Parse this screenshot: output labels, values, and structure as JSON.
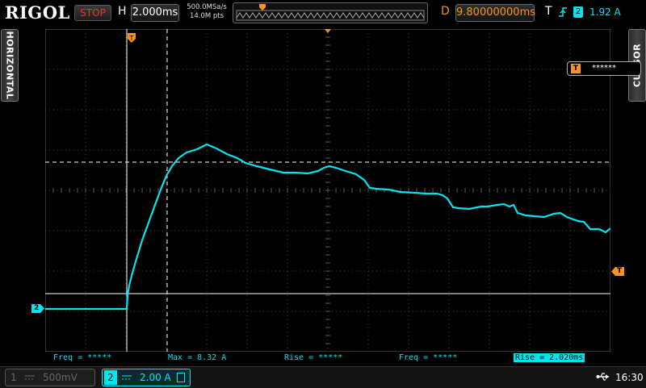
{
  "header": {
    "brand": "RIGOL",
    "run_state": "STOP",
    "horizontal_label": "H",
    "timebase": "2.000ms",
    "sample_rate": "500.0MSa/s",
    "memory_depth": "14.0M pts",
    "delay_label": "D",
    "delay": "9.80000000ms",
    "trigger_label": "T",
    "trigger_channel": "2",
    "trigger_level": "1.92 A"
  },
  "side_tabs": {
    "left": "HORIZONTAL",
    "right": "CURSOR"
  },
  "cursor_box": {
    "marker": "T",
    "value": "******"
  },
  "markers": {
    "trigger_position": "T",
    "channel2": "2",
    "trigger_level": "T"
  },
  "measurements": [
    {
      "label": "Freq = *****",
      "highlighted": false
    },
    {
      "label": "Max = 8.32 A",
      "highlighted": false
    },
    {
      "label": "Rise = *****",
      "highlighted": false
    },
    {
      "label": "Freq = *****",
      "highlighted": false
    },
    {
      "label": "Rise = 2.020ms",
      "highlighted": true
    }
  ],
  "channels": [
    {
      "number": "1",
      "scale": "500mV",
      "color": "#555555",
      "active": false
    },
    {
      "number": "2",
      "scale": "2.00 A",
      "color": "#00e5f0",
      "active": true
    }
  ],
  "status": {
    "clock": "16:30"
  },
  "colors": {
    "trace": "#00e5f0",
    "accent": "#f7931e",
    "stop": "#ff2a2a"
  },
  "icons": [
    "usb-icon",
    "trigger-edge-icon",
    "dc-coupling-icon",
    "bandwidth-limit-icon"
  ]
}
